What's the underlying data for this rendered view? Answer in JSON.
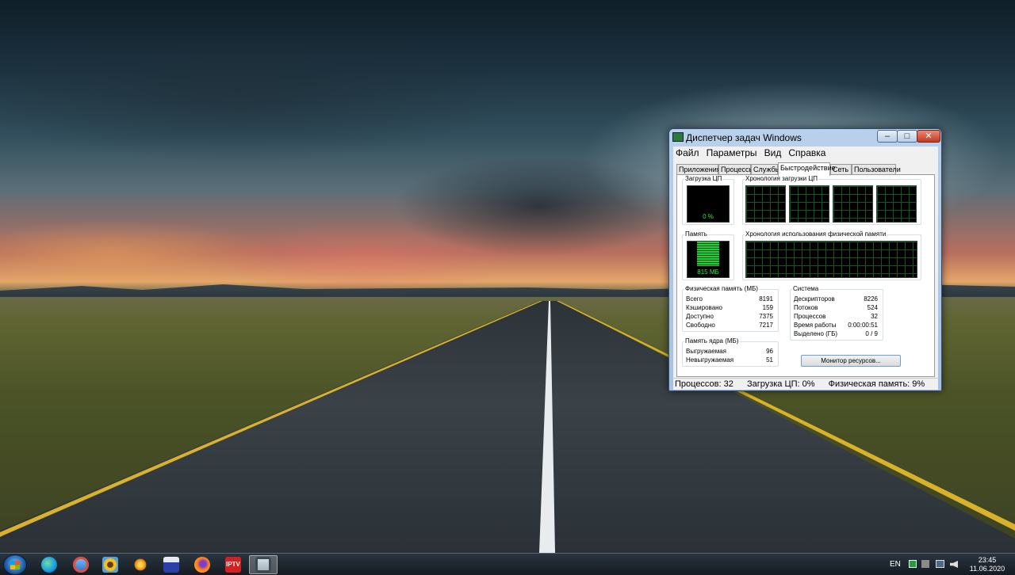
{
  "window": {
    "title": "Диспетчер задач Windows",
    "controls": {
      "minimize": "–",
      "maximize": "□",
      "close": "✕"
    },
    "menu": [
      "Файл",
      "Параметры",
      "Вид",
      "Справка"
    ],
    "tabs": [
      "Приложения",
      "Процессы",
      "Службы",
      "Быстродействие",
      "Сеть",
      "Пользователи"
    ],
    "active_tab": "Быстродействие",
    "performance": {
      "cpu_usage_label": "Загрузка ЦП",
      "cpu_usage_value": "0 %",
      "cpu_history_label": "Хронология загрузки ЦП",
      "memory_label": "Память",
      "memory_value": "815 МБ",
      "memory_history_label": "Хронология использования физической памяти",
      "physical_memory": {
        "title": "Физическая память (МБ)",
        "rows": [
          {
            "label": "Всего",
            "value": "8191"
          },
          {
            "label": "Кэшировано",
            "value": "159"
          },
          {
            "label": "Доступно",
            "value": "7375"
          },
          {
            "label": "Свободно",
            "value": "7217"
          }
        ]
      },
      "kernel_memory": {
        "title": "Память ядра (МБ)",
        "rows": [
          {
            "label": "Выгружаемая",
            "value": "96"
          },
          {
            "label": "Невыгружаемая",
            "value": "51"
          }
        ]
      },
      "system": {
        "title": "Система",
        "rows": [
          {
            "label": "Дескрипторов",
            "value": "8226"
          },
          {
            "label": "Потоков",
            "value": "524"
          },
          {
            "label": "Процессов",
            "value": "32"
          },
          {
            "label": "Время работы",
            "value": "0:00:00:51"
          },
          {
            "label": "Выделено (ГБ)",
            "value": "0 / 9"
          }
        ]
      },
      "resource_monitor_button": "Монитор ресурсов...",
      "memory_fill_fraction": 0.1
    },
    "status_bar": {
      "processes": "Процессов: 32",
      "cpu": "Загрузка ЦП: 0%",
      "memory": "Физическая память: 9%"
    }
  },
  "taskbar": {
    "items": [
      {
        "name": "edge-icon",
        "label": ""
      },
      {
        "name": "clock-tool-icon",
        "label": ""
      },
      {
        "name": "sunflower-icon",
        "label": ""
      },
      {
        "name": "media-player-icon",
        "label": ""
      },
      {
        "name": "floppy-save-icon",
        "label": ""
      },
      {
        "name": "firefox-icon",
        "label": ""
      },
      {
        "name": "iptv-checker-icon",
        "label": "IPTV"
      },
      {
        "name": "task-manager-icon",
        "label": ""
      }
    ],
    "language": "EN",
    "time": "23:45",
    "date": "11.06.2020",
    "colors": {
      "iptv": "#d42020",
      "firefox": "#ff7a1a",
      "edge": "#1aa0e0"
    }
  }
}
